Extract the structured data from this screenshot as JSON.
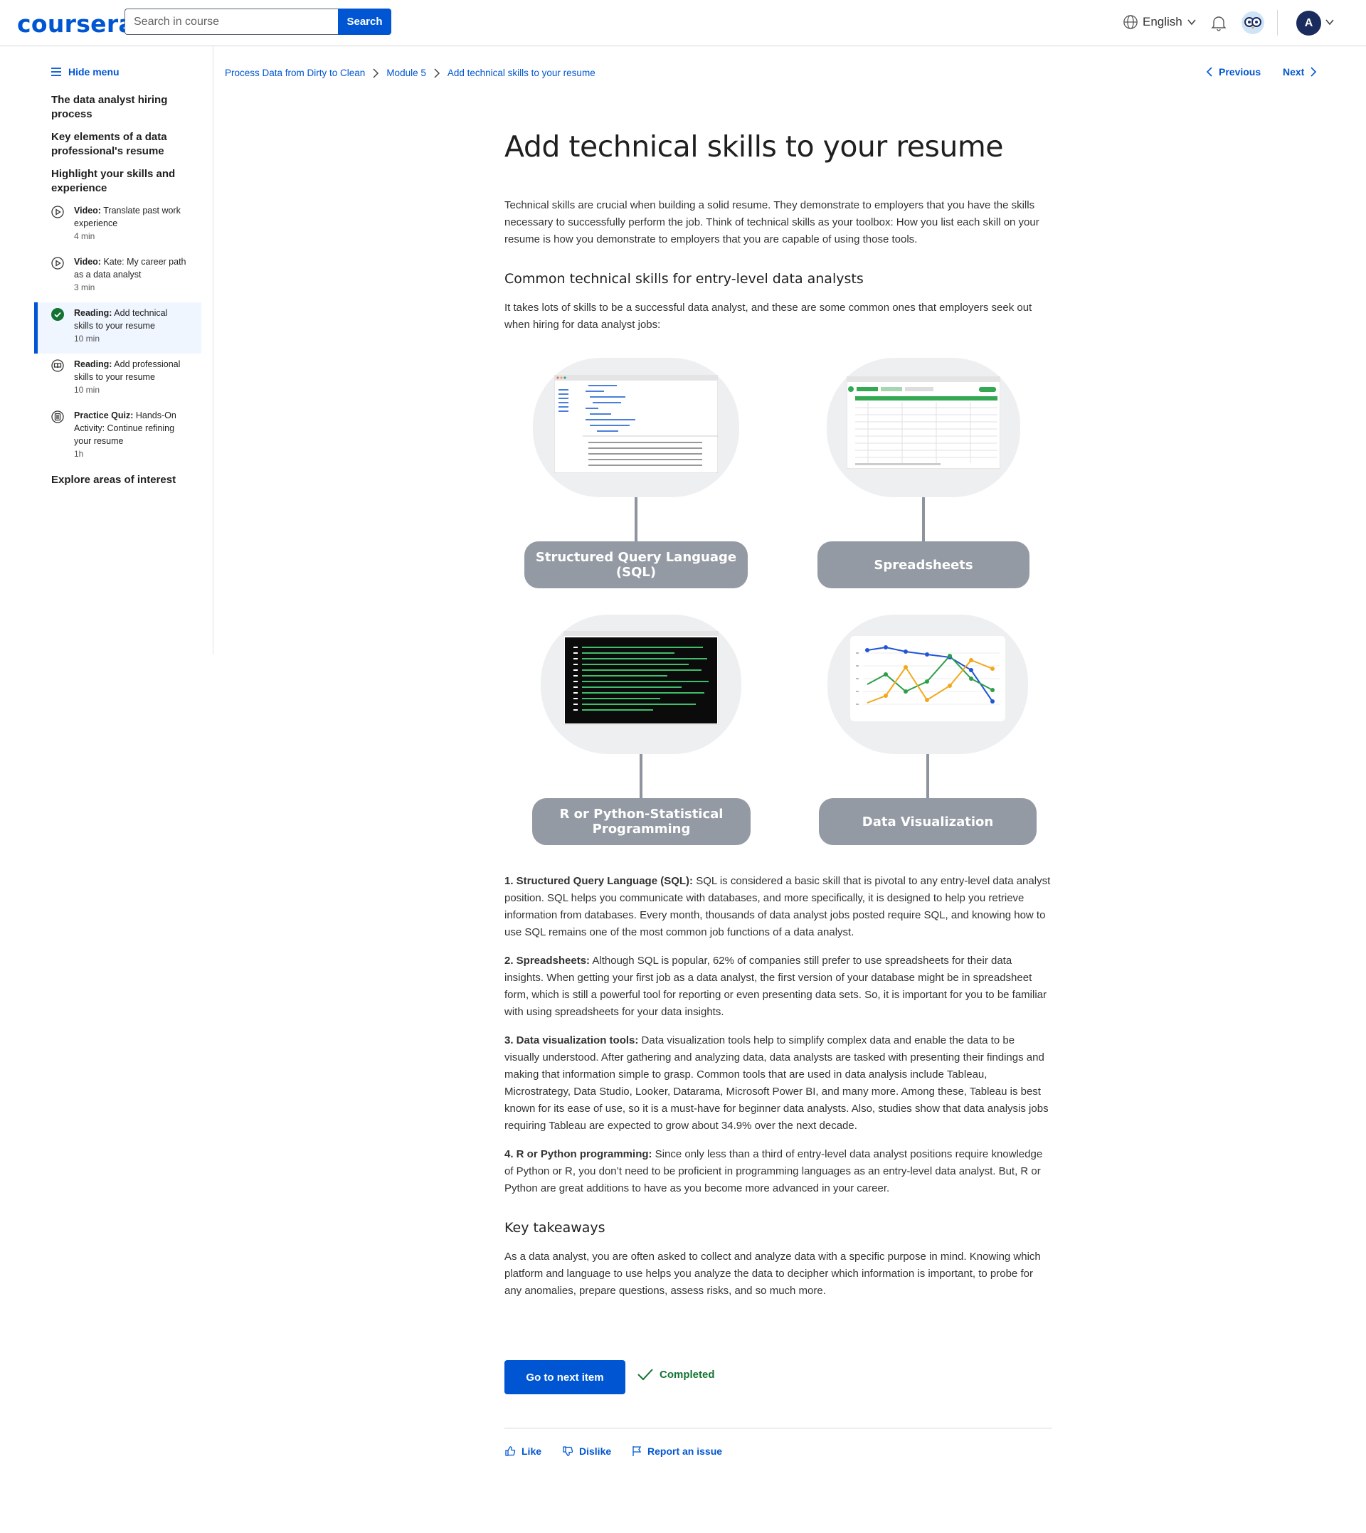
{
  "header": {
    "logo": "coursera",
    "search_placeholder": "Search in course",
    "search_button": "Search",
    "language": "English",
    "avatar_initial": "A"
  },
  "sidebar": {
    "hide_menu": "Hide menu",
    "sections": [
      "The data analyst hiring process",
      "Key elements of a data professional's resume",
      "Highlight your skills and experience",
      "Explore areas of interest"
    ],
    "items": [
      {
        "type": "Video:",
        "title": "Translate past work experience",
        "duration": "4 min",
        "icon": "play-icon"
      },
      {
        "type": "Video:",
        "title": "Kate: My career path as a data analyst",
        "duration": "3 min",
        "icon": "play-icon"
      },
      {
        "type": "Reading:",
        "title": "Add technical skills to your resume",
        "duration": "10 min",
        "icon": "check-complete-icon"
      },
      {
        "type": "Reading:",
        "title": "Add professional skills to your resume",
        "duration": "10 min",
        "icon": "book-icon"
      },
      {
        "type": "Practice Quiz:",
        "title": "Hands-On Activity: Continue refining your resume",
        "duration": "1h",
        "icon": "quiz-icon"
      }
    ]
  },
  "breadcrumb": {
    "course": "Process Data from Dirty to Clean",
    "module": "Module 5",
    "item": "Add technical skills to your resume"
  },
  "pager": {
    "previous": "Previous",
    "next": "Next"
  },
  "content": {
    "title": "Add technical skills to your resume",
    "intro": "Technical skills are crucial when building a solid resume. They demonstrate to employers that you have the skills necessary to successfully perform the job. Think of technical skills as your toolbox: How you list each skill on your resume is how you demonstrate to employers that you are capable of using those tools.",
    "subheading": "Common technical skills for entry-level data analysts",
    "subintro": "It takes lots of skills to be a successful data analyst, and these are some common ones that employers seek out when hiring for data analyst jobs:",
    "figure_labels": {
      "sql": "Structured Query Language (SQL)",
      "spreadsheets": "Spreadsheets",
      "programming": "R or Python-Statistical Programming",
      "viz": "Data Visualization"
    },
    "list": [
      {
        "lead": "1. Structured Query Language (SQL):",
        "text": " SQL is considered a basic skill that is pivotal to any entry-level data analyst position. SQL helps you communicate with databases, and more specifically, it is designed to help you retrieve information from databases. Every month, thousands of data analyst jobs posted require SQL, and knowing how to use SQL remains one of the most common job functions of a data analyst."
      },
      {
        "lead": "2. Spreadsheets:",
        "text": " Although SQL is popular, 62% of companies still prefer to use spreadsheets for their data insights. When getting your first job as a data analyst, the first version of your database might be in spreadsheet form, which is still a powerful tool for reporting or even presenting data sets. So, it is important for you to be familiar with using spreadsheets for your data insights."
      },
      {
        "lead": "3. Data visualization tools:",
        "text": " Data visualization tools help to simplify complex data and enable the data to be visually understood. After gathering and analyzing data, data analysts are tasked with presenting their findings and making that information simple to grasp. Common tools that are used in data analysis include Tableau, Microstrategy, Data Studio, Looker, Datarama, Microsoft Power BI, and many more. Among these, Tableau is best known for its ease of use, so it is a must-have for beginner data analysts. Also, studies show that data analysis jobs requiring Tableau are expected to grow about 34.9% over the next decade."
      },
      {
        "lead": "4. R or Python programming:",
        "text": " Since only less than a third of entry-level data analyst positions require knowledge of Python or R, you don’t need to be proficient in programming languages as an entry-level data analyst. But, R or Python are great additions to have as you become more advanced in your career."
      }
    ],
    "takeaways_heading": "Key takeaways",
    "takeaways": "As a data analyst, you are often asked to collect and analyze data with a specific purpose in mind. Knowing which platform and language to use helps you analyze the data to decipher which information is important, to probe for any anomalies, prepare questions, assess risks, and so much more."
  },
  "footer": {
    "next_button": "Go to next item",
    "completed": "Completed",
    "like": "Like",
    "dislike": "Dislike",
    "report": "Report an issue"
  },
  "colors": {
    "primary": "#0056d2",
    "success": "#137333",
    "label_gray": "#949aa3"
  }
}
